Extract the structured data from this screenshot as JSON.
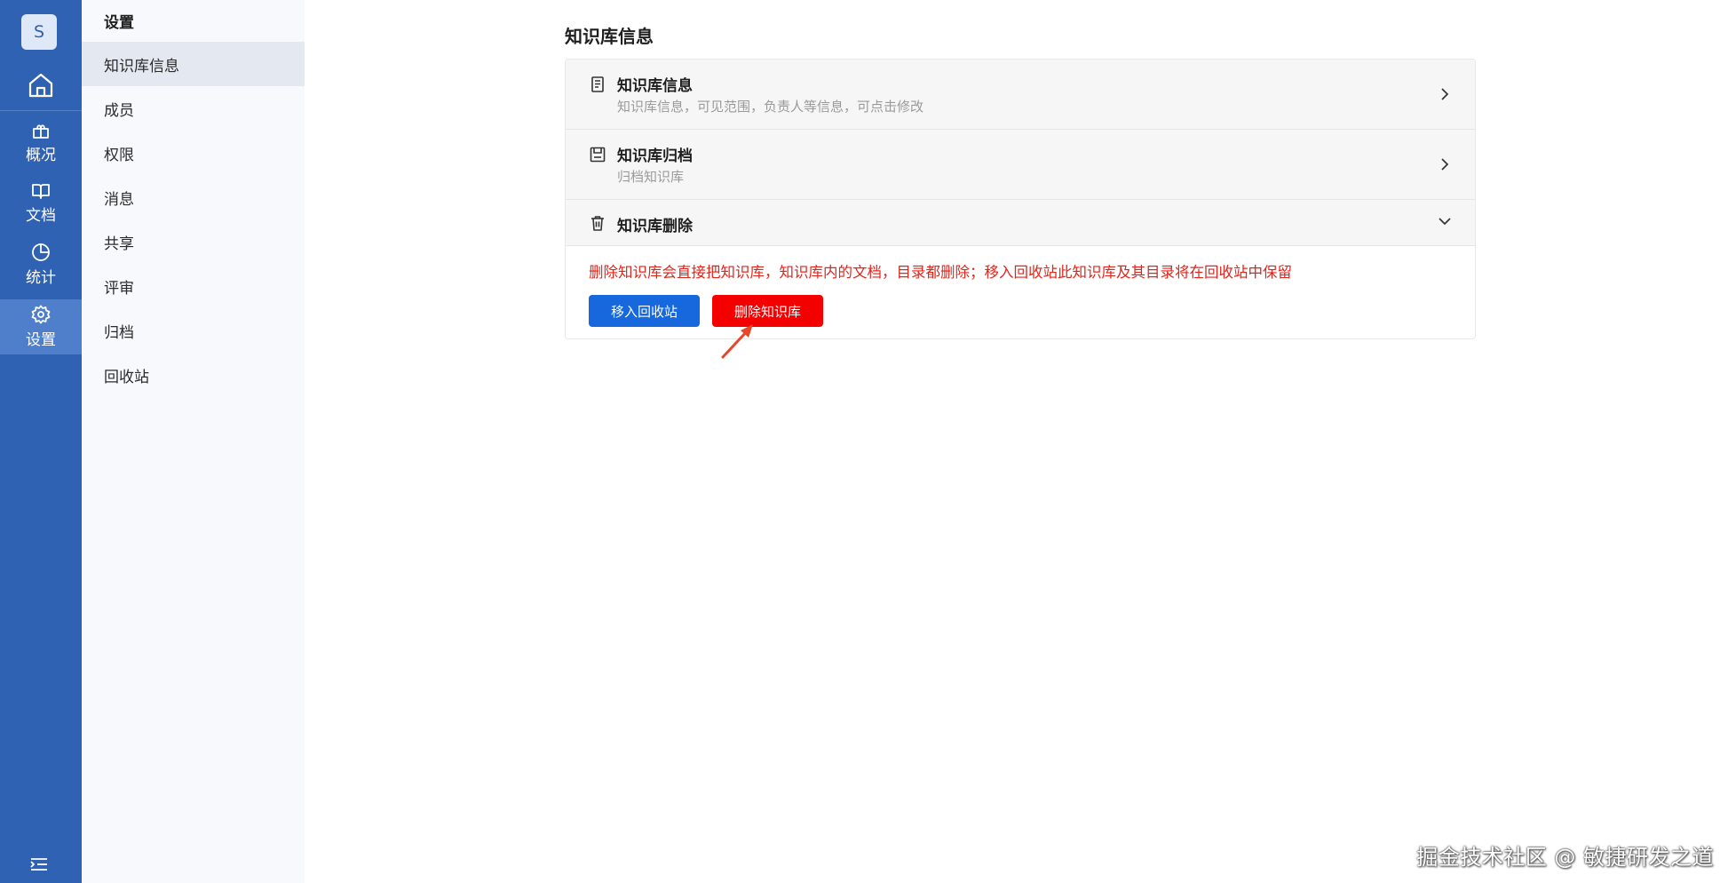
{
  "rail": {
    "avatar": "S",
    "items": [
      {
        "label": "概况",
        "icon": "box-icon"
      },
      {
        "label": "文档",
        "icon": "book-icon"
      },
      {
        "label": "统计",
        "icon": "pie-chart-icon"
      },
      {
        "label": "设置",
        "icon": "gear-icon"
      }
    ],
    "active_color": "#4f7fcb",
    "bg_color": "#2f62b3"
  },
  "sidebar": {
    "title": "设置",
    "items": [
      {
        "label": "知识库信息"
      },
      {
        "label": "成员"
      },
      {
        "label": "权限"
      },
      {
        "label": "消息"
      },
      {
        "label": "共享"
      },
      {
        "label": "评审"
      },
      {
        "label": "归档"
      },
      {
        "label": "回收站"
      }
    ]
  },
  "main": {
    "title": "知识库信息",
    "sections": [
      {
        "title": "知识库信息",
        "subtitle": "知识库信息，可见范围，负责人等信息，可点击修改",
        "icon": "document-icon"
      },
      {
        "title": "知识库归档",
        "subtitle": "归档知识库",
        "icon": "archive-icon"
      },
      {
        "title": "知识库删除",
        "icon": "trash-icon"
      }
    ],
    "warning": "删除知识库会直接把知识库，知识库内的文档，目录都删除；移入回收站此知识库及其目录将在回收站中保留",
    "buttons": {
      "recycle": "移入回收站",
      "delete": "删除知识库"
    },
    "colors": {
      "primary": "#1668dc",
      "danger": "#f50000",
      "warning_text": "#e0251b"
    }
  },
  "watermark": "掘金技术社区 @ 敏捷研发之道"
}
